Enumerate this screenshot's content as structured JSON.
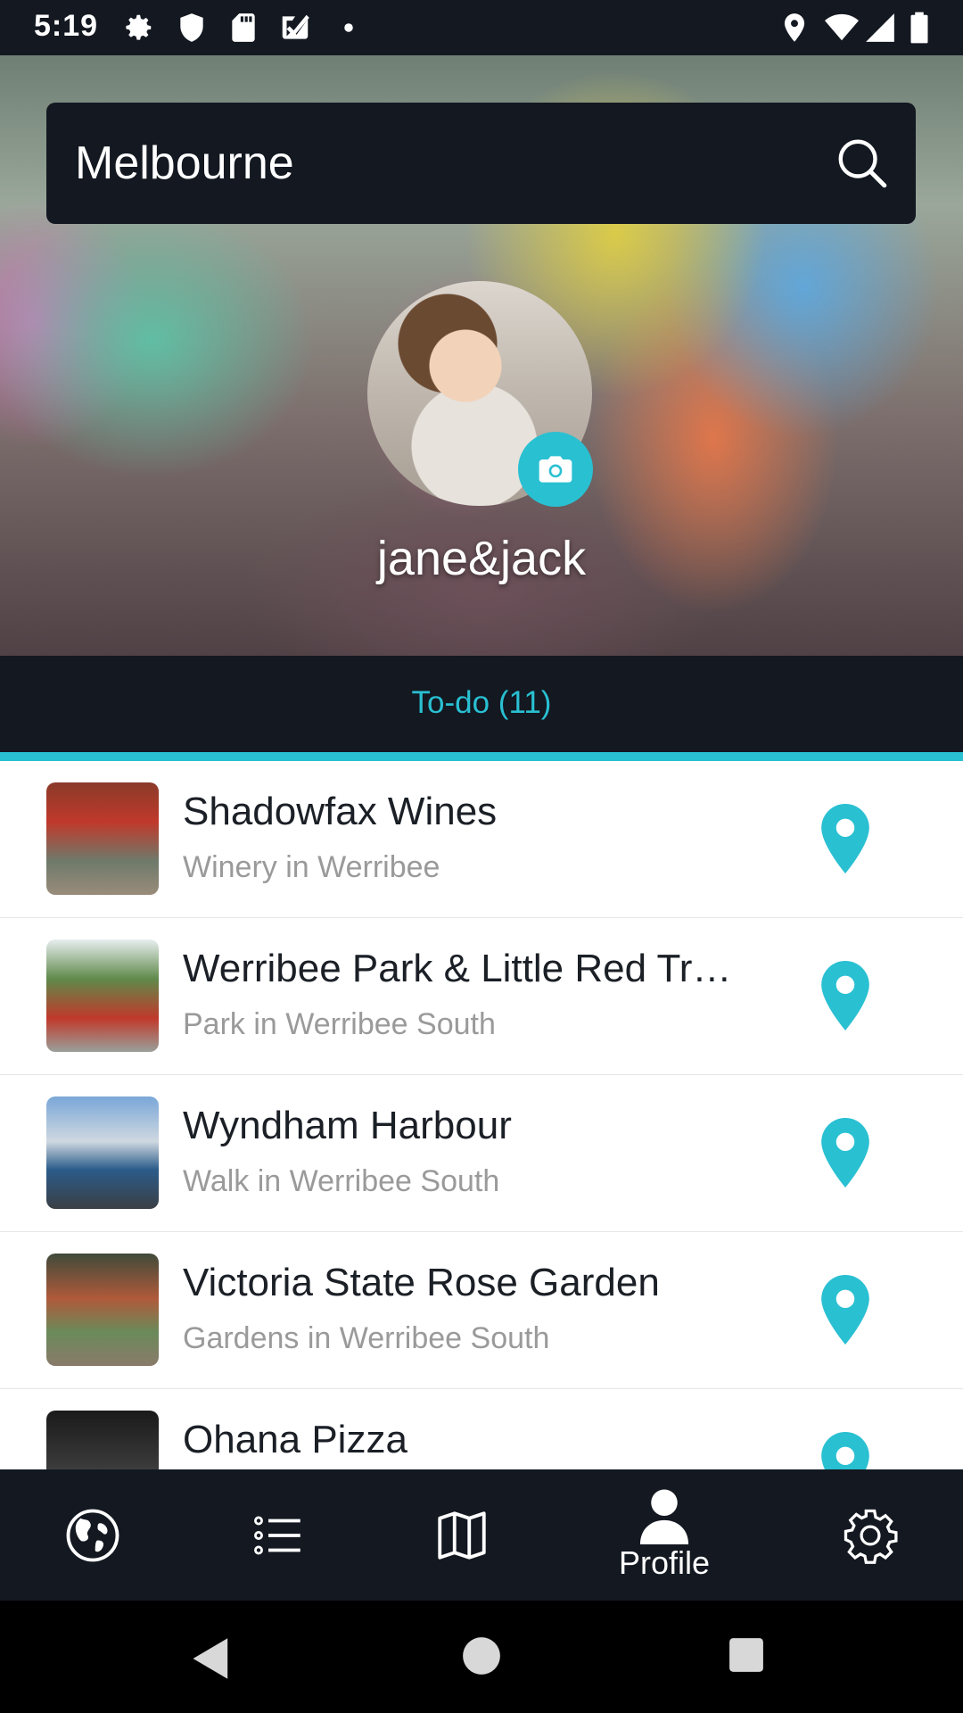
{
  "status_bar": {
    "time": "5:19",
    "left_icons": [
      "settings-icon",
      "shield-icon",
      "sd-card-icon",
      "check-icon",
      "dot-icon"
    ],
    "right_icons": [
      "location-icon",
      "wifi-icon",
      "signal-icon",
      "battery-icon"
    ]
  },
  "search": {
    "value": "Melbourne",
    "icon": "search-icon"
  },
  "profile": {
    "username": "jane&jack",
    "camera_icon": "camera-icon"
  },
  "tabs": [
    {
      "label": "To-do (11)",
      "active": true
    }
  ],
  "colors": {
    "accent": "#29c0d2",
    "dark": "#131821",
    "title": "#1b1f26",
    "subtitle": "#9a9a9a"
  },
  "places": [
    {
      "title": "Shadowfax Wines",
      "subtitle": "Winery in Werribee",
      "icon": "map-pin-icon"
    },
    {
      "title": "Werribee Park & Little Red Tr…",
      "subtitle": "Park in Werribee South",
      "icon": "map-pin-icon"
    },
    {
      "title": "Wyndham Harbour",
      "subtitle": "Walk in Werribee South",
      "icon": "map-pin-icon"
    },
    {
      "title": "Victoria State Rose Garden",
      "subtitle": "Gardens in Werribee South",
      "icon": "map-pin-icon"
    },
    {
      "title": "Ohana Pizza",
      "subtitle": "",
      "icon": "map-pin-icon"
    }
  ],
  "bottom_nav": [
    {
      "icon": "globe-icon",
      "label": ""
    },
    {
      "icon": "list-icon",
      "label": ""
    },
    {
      "icon": "map-icon",
      "label": ""
    },
    {
      "icon": "profile-icon",
      "label": "Profile",
      "active": true
    },
    {
      "icon": "gear-icon",
      "label": ""
    }
  ],
  "system_nav": [
    "back-icon",
    "home-icon",
    "recents-icon"
  ]
}
